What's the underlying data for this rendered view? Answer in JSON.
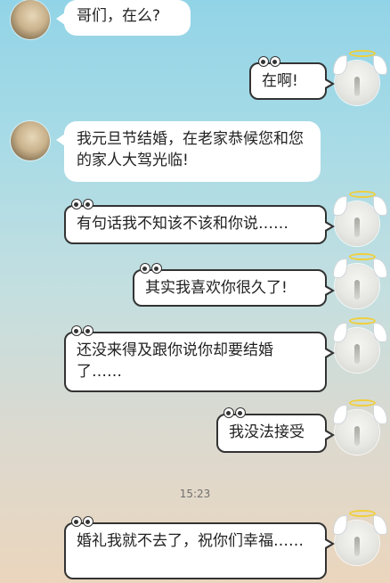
{
  "messages": [
    {
      "side": "in",
      "text": "哥们，在么?"
    },
    {
      "side": "out",
      "text": "在啊!"
    },
    {
      "side": "in",
      "text": "我元旦节结婚，在老家恭候您和您的家人大驾光临!"
    },
    {
      "side": "out",
      "text": "有句话我不知该不该和你说……"
    },
    {
      "side": "out",
      "text": "其实我喜欢你很久了!"
    },
    {
      "side": "out",
      "text": "还没来得及跟你说你却要结婚了……"
    },
    {
      "side": "out",
      "text": "我没法接受"
    },
    {
      "side": "out",
      "text": "婚礼我就不去了，祝你们幸福……"
    }
  ],
  "timestamp": "15:23"
}
